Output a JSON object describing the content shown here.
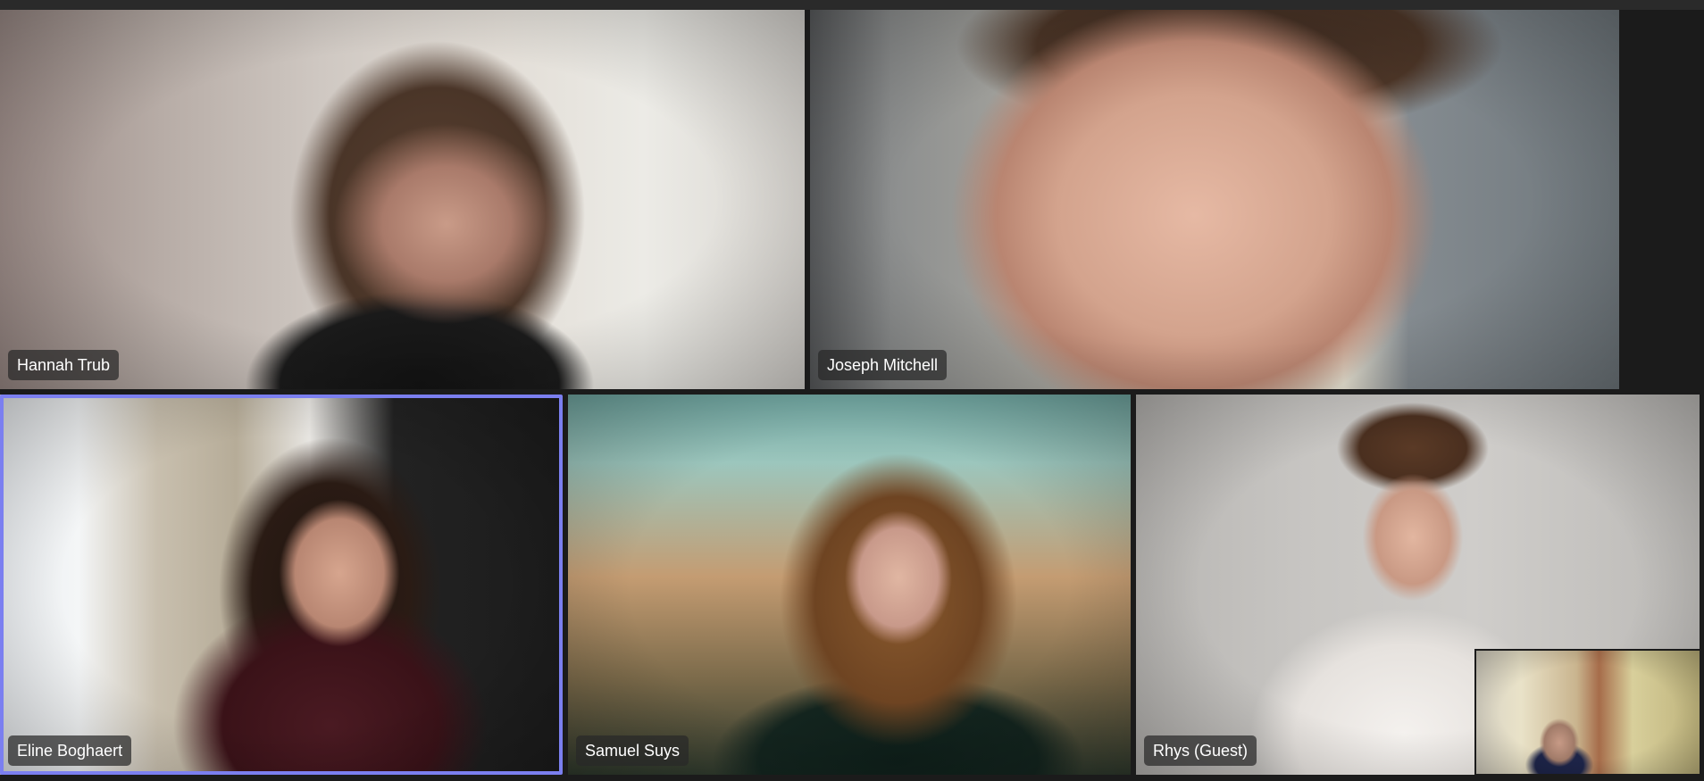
{
  "app": {
    "type": "video-meeting-gallery"
  },
  "participants": [
    {
      "name": "Hannah Trub",
      "active_speaker": false
    },
    {
      "name": "Joseph Mitchell",
      "active_speaker": false
    },
    {
      "name": "Eline Boghaert",
      "active_speaker": true
    },
    {
      "name": "Samuel Suys",
      "active_speaker": false
    },
    {
      "name": "Rhys (Guest)",
      "active_speaker": false
    }
  ],
  "self_view": {
    "visible": true
  },
  "colors": {
    "background": "#1b1b1b",
    "active_speaker_border": "#7b7ff0",
    "name_tag_text": "#ffffff"
  }
}
